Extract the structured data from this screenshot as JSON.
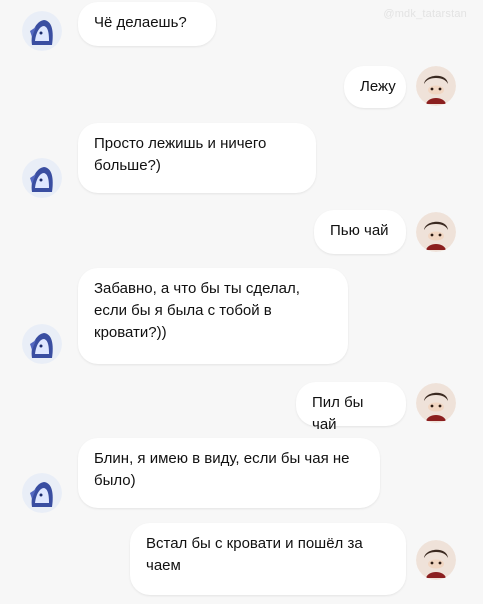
{
  "watermark": "@mdk_tatarstan",
  "messages": [
    {
      "side": "in",
      "text": "Чё делаешь?"
    },
    {
      "side": "out",
      "text": "Лежу"
    },
    {
      "side": "in",
      "text": "Просто лежишь и ничего больше?)"
    },
    {
      "side": "out",
      "text": "Пью чай"
    },
    {
      "side": "in",
      "text": "Забавно, а что бы ты сделал, если бы я была с тобой в кровати?))"
    },
    {
      "side": "out",
      "text": "Пил бы чай"
    },
    {
      "side": "in",
      "text": "Блин, я имею в виду, если бы чая не было)"
    },
    {
      "side": "out",
      "text": "Встал бы с кровати и пошёл за чаем"
    }
  ],
  "avatars": {
    "in": "anime-girl-avatar",
    "out": "anime-boy-avatar"
  },
  "colors": {
    "bubble": "#ffffff",
    "background": "#f7f7f7",
    "text": "#111111"
  }
}
